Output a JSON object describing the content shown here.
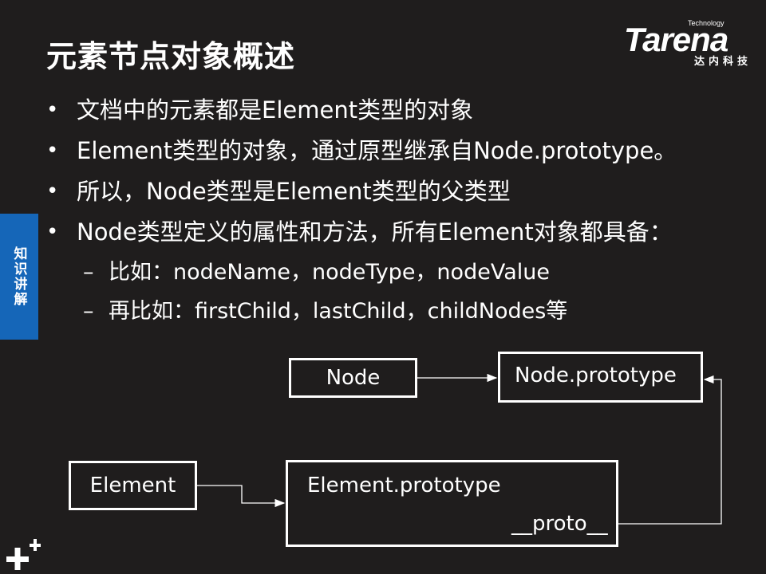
{
  "title": "元素节点对象概述",
  "logo": {
    "small": "Technology",
    "main": "Tarena",
    "cn": "达内科技"
  },
  "side_tab": "知识讲解",
  "bullets": [
    "文档中的元素都是Element类型的对象",
    "Element类型的对象，通过原型继承自Node.prototype。",
    "所以，Node类型是Element类型的父类型",
    "Node类型定义的属性和方法，所有Element对象都具备："
  ],
  "sub_bullets": [
    "比如：nodeName，nodeType，nodeValue",
    "再比如：firstChild，lastChild，childNodes等"
  ],
  "diagram": {
    "node": "Node",
    "node_prototype": "Node.prototype",
    "element": "Element",
    "element_prototype": "Element.prototype",
    "proto": "__proto__"
  }
}
